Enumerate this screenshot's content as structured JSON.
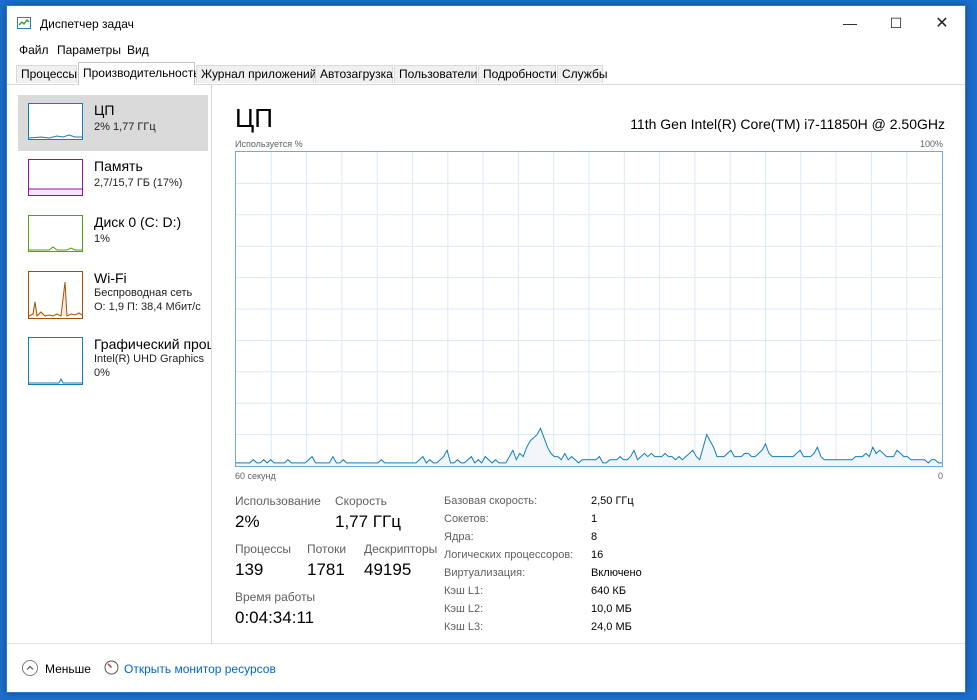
{
  "window": {
    "title": "Диспетчер задач",
    "controls": {
      "minimize": "—",
      "maximize": "☐",
      "close": "✕"
    }
  },
  "menu": {
    "file": "Файл",
    "options": "Параметры",
    "view": "Вид"
  },
  "tabs": {
    "processes": "Процессы",
    "performance": "Производительность",
    "app_history": "Журнал приложений",
    "startup": "Автозагрузка",
    "users": "Пользователи",
    "details": "Подробности",
    "services": "Службы"
  },
  "resources": {
    "cpu": {
      "title": "ЦП",
      "sub": "2% 1,77 ГГц"
    },
    "memory": {
      "title": "Память",
      "sub": "2,7/15,7 ГБ (17%)"
    },
    "disk": {
      "title": "Диск 0 (C: D:)",
      "sub": "1%"
    },
    "wifi": {
      "title": "Wi-Fi",
      "sub1": "Беспроводная сеть",
      "sub2": "О: 1,9 П: 38,4 Мбит/с"
    },
    "gpu": {
      "title": "Графический процессор",
      "sub1": "Intel(R) UHD Graphics",
      "sub2": "0%"
    }
  },
  "main": {
    "title": "ЦП",
    "model": "11th Gen Intel(R) Core(TM) i7-11850H @ 2.50GHz",
    "graph_label": "Используется %",
    "graph_max": "100%",
    "graph_time": "60 секунд",
    "graph_min": "0"
  },
  "chart_data": {
    "type": "area",
    "ylim": [
      0,
      100
    ],
    "grid": true,
    "values": [
      1,
      1,
      1,
      1,
      1,
      2,
      1,
      1,
      2,
      1,
      2,
      1,
      1,
      1,
      1,
      2,
      1,
      1,
      1,
      1,
      1,
      2,
      3,
      1,
      1,
      1,
      1,
      1,
      3,
      1,
      1,
      2,
      1,
      1,
      1,
      1,
      1,
      1,
      1,
      1,
      1,
      1,
      2,
      1,
      1,
      1,
      1,
      1,
      1,
      1,
      1,
      1,
      1,
      2,
      3,
      1,
      2,
      1,
      1,
      2,
      3,
      5,
      1,
      1,
      2,
      1,
      1,
      2,
      3,
      1,
      2,
      1,
      3,
      2,
      1,
      2,
      1,
      1,
      1,
      3,
      5,
      2,
      4,
      3,
      6,
      8,
      9,
      10,
      12,
      9,
      6,
      4,
      3,
      3,
      2,
      4,
      2,
      3,
      2,
      1,
      2,
      2,
      2,
      2,
      2,
      3,
      1,
      1,
      2,
      2,
      2,
      3,
      2,
      2,
      3,
      5,
      2,
      3,
      4,
      3,
      4,
      3,
      3,
      3,
      4,
      3,
      3,
      2,
      3,
      2,
      3,
      4,
      5,
      3,
      2,
      6,
      10,
      8,
      6,
      3,
      3,
      3,
      4,
      5,
      3,
      3,
      3,
      4,
      4,
      3,
      3,
      4,
      5,
      7,
      4,
      3,
      3,
      3,
      3,
      3,
      3,
      3,
      4,
      5,
      3,
      3,
      3,
      4,
      6,
      3,
      2,
      2,
      2,
      2,
      2,
      2,
      2,
      2,
      2,
      3,
      3,
      3,
      4,
      3,
      6,
      4,
      5,
      4,
      3,
      3,
      3,
      5,
      4,
      3,
      3,
      2,
      2,
      2,
      2,
      2,
      1,
      2,
      2,
      1,
      1
    ]
  },
  "stats": {
    "utilization_label": "Использование",
    "utilization": "2%",
    "speed_label": "Скорость",
    "speed": "1,77 ГГц",
    "processes_label": "Процессы",
    "processes": "139",
    "threads_label": "Потоки",
    "threads": "1781",
    "handles_label": "Дескрипторы",
    "handles": "49195",
    "uptime_label": "Время работы",
    "uptime": "0:04:34:11"
  },
  "specs": {
    "base_speed_label": "Базовая скорость:",
    "base_speed": "2,50 ГГц",
    "sockets_label": "Сокетов:",
    "sockets": "1",
    "cores_label": "Ядра:",
    "cores": "8",
    "logical_label": "Логических процессоров:",
    "logical": "16",
    "virtualization_label": "Виртуализация:",
    "virtualization": "Включено",
    "l1_label": "Кэш L1:",
    "l1": "640 КБ",
    "l2_label": "Кэш L2:",
    "l2": "10,0 МБ",
    "l3_label": "Кэш L3:",
    "l3": "24,0 МБ"
  },
  "footer": {
    "fewer": "Меньше",
    "monitor": "Открыть монитор ресурсов"
  }
}
